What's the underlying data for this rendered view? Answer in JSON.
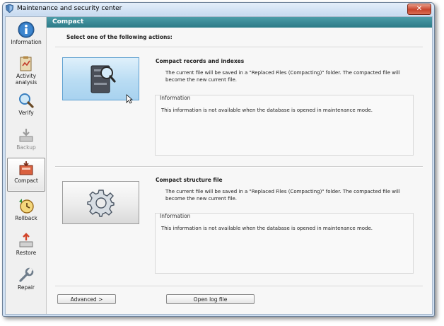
{
  "window": {
    "title": "Maintenance and security center",
    "close_label": "✕"
  },
  "sidebar": {
    "items": [
      {
        "label": "Information",
        "icon": "info-icon"
      },
      {
        "label": "Activity\nanalysis",
        "icon": "clipboard-icon"
      },
      {
        "label": "Verify",
        "icon": "magnifier-icon"
      },
      {
        "label": "Backup",
        "icon": "backup-icon",
        "disabled": true
      },
      {
        "label": "Compact",
        "icon": "compact-icon",
        "active": true
      },
      {
        "label": "Rollback",
        "icon": "clock-icon"
      },
      {
        "label": "Restore",
        "icon": "restore-icon"
      },
      {
        "label": "Repair",
        "icon": "wrench-icon"
      }
    ]
  },
  "header": {
    "title": "Compact"
  },
  "prompt": "Select one of the following actions:",
  "sections": [
    {
      "title": "Compact records and indexes",
      "description": "The current file will be saved in a \"Replaced Files (Compacting)\" folder. The compacted file will become the new current file.",
      "info_legend": "Information",
      "info_text": "This information is not available when the database is opened in maintenance mode."
    },
    {
      "title": "Compact structure file",
      "description": "The current file will be saved in a \"Replaced Files (Compacting)\" folder. The compacted file will become the new current file.",
      "info_legend": "Information",
      "info_text": "This information is not available when the database is opened in maintenance mode."
    }
  ],
  "footer": {
    "advanced_label": "Advanced >",
    "open_log_label": "Open log file"
  },
  "colors": {
    "header": "#2c7a87",
    "hover_button": "#b9dcf3"
  }
}
